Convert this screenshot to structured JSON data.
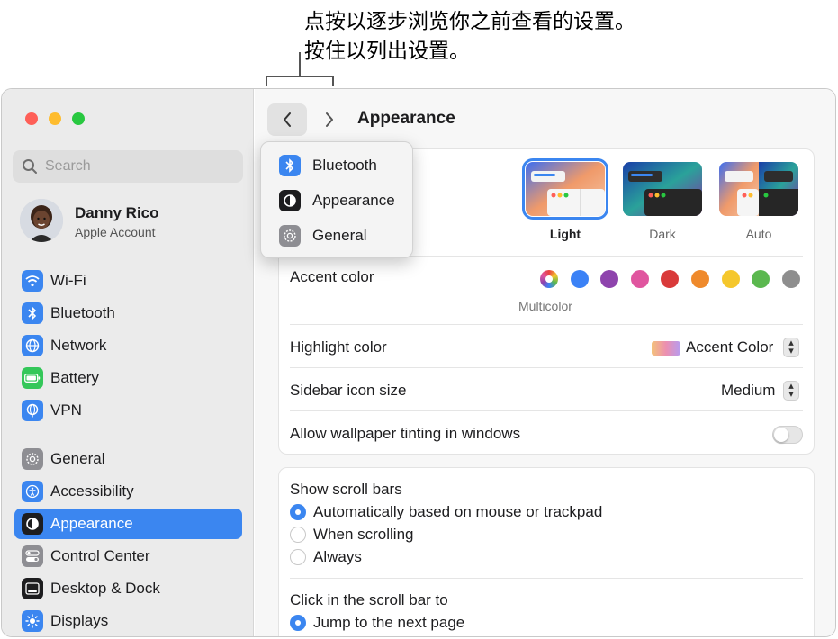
{
  "callout": {
    "line1": "点按以逐步浏览你之前查看的设置。",
    "line2": "按住以列出设置。"
  },
  "search": {
    "placeholder": "Search"
  },
  "account": {
    "name": "Danny Rico",
    "subtitle": "Apple Account"
  },
  "sidebar": {
    "items": [
      {
        "label": "Wi-Fi",
        "icon": "wifi-icon",
        "color": "#3b86f0"
      },
      {
        "label": "Bluetooth",
        "icon": "bluetooth-icon",
        "color": "#3b86f0"
      },
      {
        "label": "Network",
        "icon": "globe-icon",
        "color": "#3b86f0"
      },
      {
        "label": "Battery",
        "icon": "battery-icon",
        "color": "#34c759"
      },
      {
        "label": "VPN",
        "icon": "vpn-globe-icon",
        "color": "#3b86f0"
      },
      {
        "label": "General",
        "icon": "gear-icon",
        "color": "#8e8e93"
      },
      {
        "label": "Accessibility",
        "icon": "accessibility-icon",
        "color": "#3b86f0"
      },
      {
        "label": "Appearance",
        "icon": "appearance-icon",
        "color": "#1d1d1f",
        "active": true
      },
      {
        "label": "Control Center",
        "icon": "control-center-icon",
        "color": "#8e8e93"
      },
      {
        "label": "Desktop & Dock",
        "icon": "desktop-dock-icon",
        "color": "#1d1d1f"
      },
      {
        "label": "Displays",
        "icon": "sun-icon",
        "color": "#3b86f0"
      }
    ]
  },
  "toolbar": {
    "title": "Appearance"
  },
  "history_menu": {
    "items": [
      {
        "label": "Bluetooth",
        "icon": "bluetooth-icon"
      },
      {
        "label": "Appearance",
        "icon": "appearance-icon"
      },
      {
        "label": "General",
        "icon": "gear-icon"
      }
    ]
  },
  "appearance": {
    "themes": [
      {
        "label": "Light",
        "selected": true
      },
      {
        "label": "Dark",
        "selected": false
      },
      {
        "label": "Auto",
        "selected": false
      }
    ]
  },
  "accent": {
    "label": "Accent color",
    "selected_label": "Multicolor",
    "colors": [
      "multicolor",
      "#3b82f6",
      "#8e44ad",
      "#e0559f",
      "#d93a3a",
      "#ef8a2c",
      "#f5c72c",
      "#5bb84f",
      "#8e8e8e"
    ]
  },
  "highlight": {
    "label": "Highlight color",
    "value": "Accent Color"
  },
  "sidebar_icon_size": {
    "label": "Sidebar icon size",
    "value": "Medium"
  },
  "wallpaper_tinting": {
    "label": "Allow wallpaper tinting in windows",
    "enabled": false
  },
  "scroll_bars": {
    "label": "Show scroll bars",
    "options": [
      "Automatically based on mouse or trackpad",
      "When scrolling",
      "Always"
    ],
    "selected": "Automatically based on mouse or trackpad"
  },
  "scroll_click": {
    "label": "Click in the scroll bar to",
    "options": [
      "Jump to the next page"
    ],
    "selected": "Jump to the next page"
  }
}
